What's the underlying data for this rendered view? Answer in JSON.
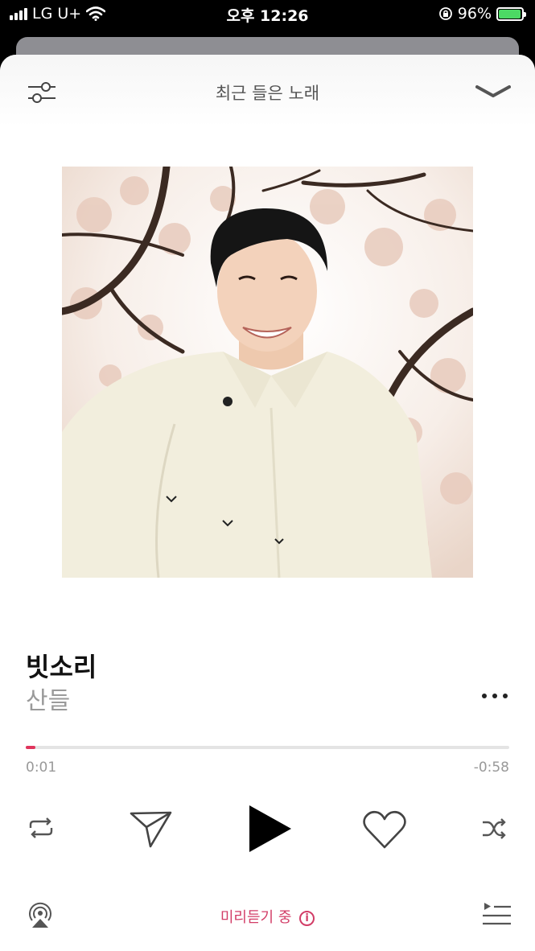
{
  "status": {
    "carrier": "LG U+",
    "time": "오후 12:26",
    "battery": "96%",
    "battery_level": 0.96
  },
  "header": {
    "title": "최근 들은 노래"
  },
  "track": {
    "title": "빗소리",
    "artist": "산들"
  },
  "playback": {
    "elapsed": "0:01",
    "remaining": "-0:58",
    "progress": 0.02
  },
  "footer": {
    "preview_label": "미리듣기 중",
    "info_glyph": "i"
  },
  "colors": {
    "accent": "#e0345c",
    "preview": "#d23d67",
    "battery": "#4cd964"
  },
  "icons": [
    "signal-icon",
    "wifi-icon",
    "lock-rotation-icon",
    "battery-icon",
    "filter-icon",
    "chevron-down-icon",
    "more-icon",
    "repeat-icon",
    "send-icon",
    "play-icon",
    "heart-icon",
    "shuffle-icon",
    "airplay-icon",
    "queue-icon"
  ]
}
